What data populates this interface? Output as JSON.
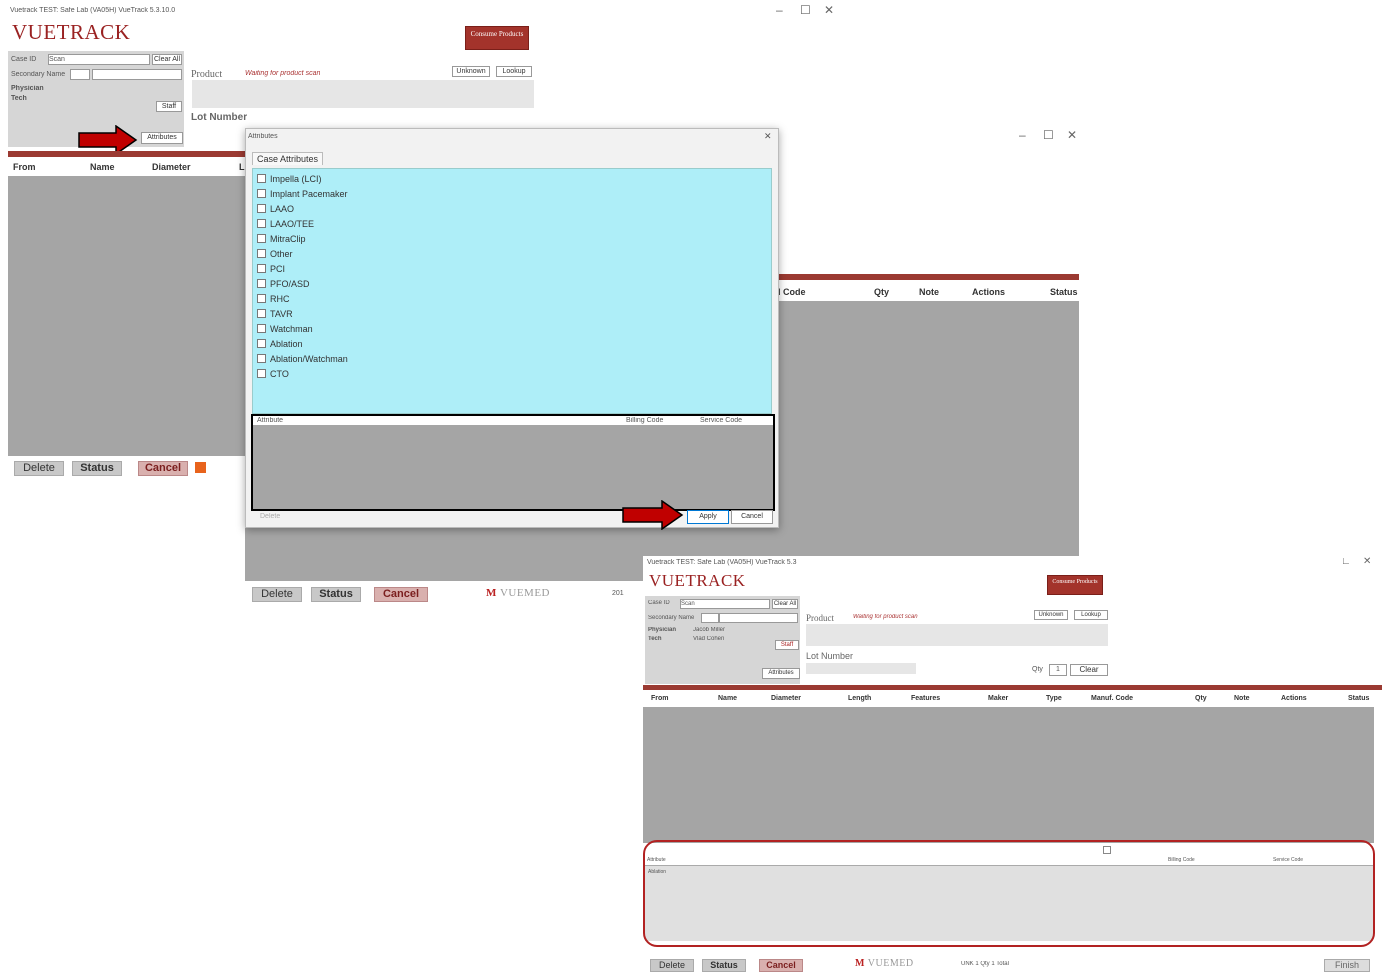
{
  "window1": {
    "titlebar": "Vuetrack TEST: Safe Lab  (VA05H) VueTrack 5.3.10.0",
    "logo": "VUETRACK",
    "consume_button": "Consume Products",
    "case_id_label": "Case ID",
    "case_id_value": "Scan",
    "clear_all": "Clear All",
    "secondary_name_label": "Secondary Name",
    "physician_label": "Physician",
    "tech_label": "Tech",
    "staff_button": "Staff",
    "attributes_button": "Attributes",
    "product_label": "Product",
    "product_status": "Waiting for product scan",
    "unknown_button": "Unknown",
    "lookup_button": "Lookup",
    "lot_number_label": "Lot Number",
    "columns": [
      "From",
      "Name",
      "Diameter",
      "L"
    ],
    "delete": "Delete",
    "status": "Status",
    "cancel": "Cancel"
  },
  "window2": {
    "columns": [
      "d Code",
      "Qty",
      "Note",
      "Actions",
      "Status"
    ],
    "delete": "Delete",
    "status": "Status",
    "cancel": "Cancel",
    "footer_logo": "VUEMED",
    "footer_text": "201"
  },
  "dialog": {
    "title": "Attributes",
    "tab": "Case Attributes",
    "items": [
      "Impella (LCI)",
      "Implant Pacemaker",
      "LAAO",
      "LAAO/TEE",
      "MitraClip",
      "Other",
      "PCI",
      "PFO/ASD",
      "RHC",
      "TAVR",
      "Watchman",
      "Ablation",
      "Ablation/Watchman",
      "CTO"
    ],
    "table_columns": [
      "Attribute",
      "Billing Code",
      "Service Code"
    ],
    "delete_button": "Delete",
    "apply_button": "Apply",
    "cancel_button": "Cancel"
  },
  "window3": {
    "titlebar": "Vuetrack TEST: Safe Lab  (VA05H) VueTrack 5.3",
    "logo": "VUETRACK",
    "consume_button": "Consume Products",
    "case_id_label": "Case ID",
    "case_id_value": "Scan",
    "clear_all": "Clear All",
    "secondary_name_label": "Secondary Name",
    "physician_label": "Physician",
    "physician_value": "Jacob Miller",
    "tech_label": "Tech",
    "tech_value": "Vlad Cohen",
    "staff_button": "Staff",
    "attributes_button": "Attributes",
    "product_label": "Product",
    "product_status": "Waiting for product scan",
    "unknown_button": "Unknown",
    "lookup_button": "Lookup",
    "lot_number_label": "Lot Number",
    "qty_label": "Qty",
    "qty_value": "1",
    "clear_button": "Clear",
    "columns": [
      "From",
      "Name",
      "Diameter",
      "Length",
      "Features",
      "Maker",
      "Type",
      "Manuf. Code",
      "Qty",
      "Note",
      "Actions",
      "Status"
    ],
    "attr_columns": [
      "Attribute",
      "Billing Code",
      "Service Code"
    ],
    "attr_rows": [
      "Ablation"
    ],
    "delete": "Delete",
    "status": "Status",
    "cancel": "Cancel",
    "footer_logo": "VUEMED",
    "footer_text": "UNK  1     Qty  1     Total",
    "finish": "Finish"
  },
  "colors": {
    "brand_red": "#9b3a32",
    "dialog_list_bg": "#aeeef8",
    "arrow_red": "#c00000",
    "highlight_border": "#b22222"
  }
}
